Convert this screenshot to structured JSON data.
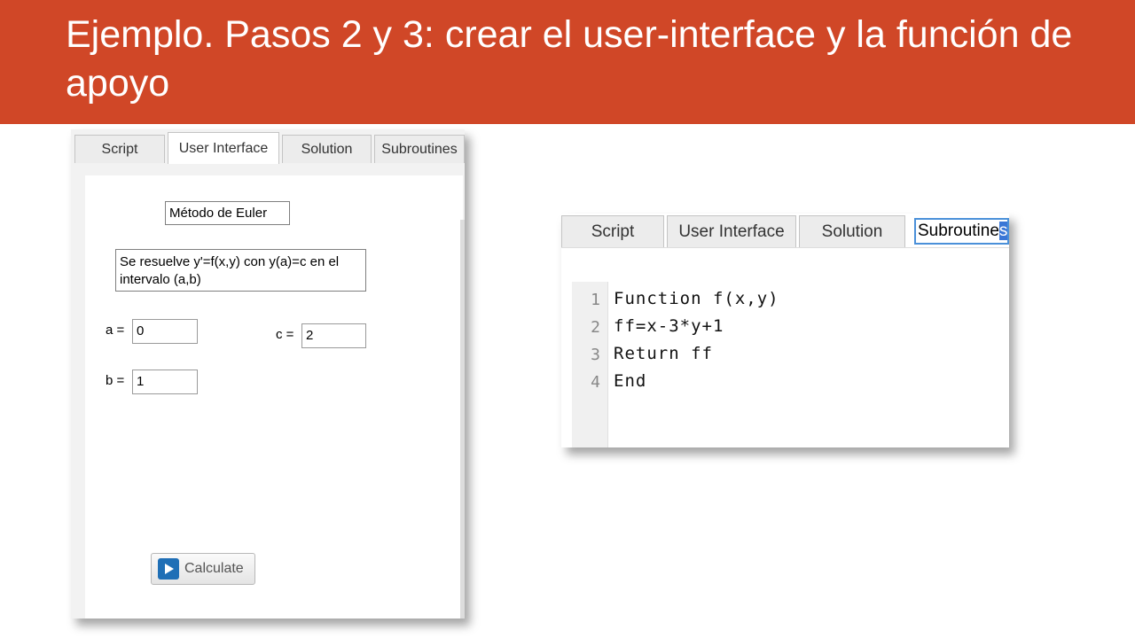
{
  "slide": {
    "title": "Ejemplo. Pasos 2 y 3: crear el user-interface y la función de apoyo"
  },
  "left_panel": {
    "tabs": [
      "Script",
      "User Interface",
      "Solution",
      "Subroutines"
    ],
    "active_tab": "User Interface",
    "title_label": "Método de Euler",
    "description": "Se resuelve y'=f(x,y) con y(a)=c en el intervalo (a,b)",
    "fields": {
      "a": {
        "label": "a =",
        "value": "0"
      },
      "b": {
        "label": "b =",
        "value": "1"
      },
      "c": {
        "label": "c =",
        "value": "2"
      }
    },
    "calculate_label": "Calculate"
  },
  "right_panel": {
    "tabs": [
      "Script",
      "User Interface",
      "Solution",
      "Subroutines"
    ],
    "active_tab": "Subroutines",
    "active_tab_text": "Subroutine",
    "active_tab_selected": "s",
    "code_lines": [
      {
        "num": "1",
        "text": "Function f(x,y)"
      },
      {
        "num": "2",
        "text": "ff=x-3*y+1"
      },
      {
        "num": "3",
        "text": "Return ff"
      },
      {
        "num": "4",
        "text": "End"
      }
    ]
  },
  "colors": {
    "header": "#d04727",
    "accent_blue": "#1f6fb6"
  }
}
